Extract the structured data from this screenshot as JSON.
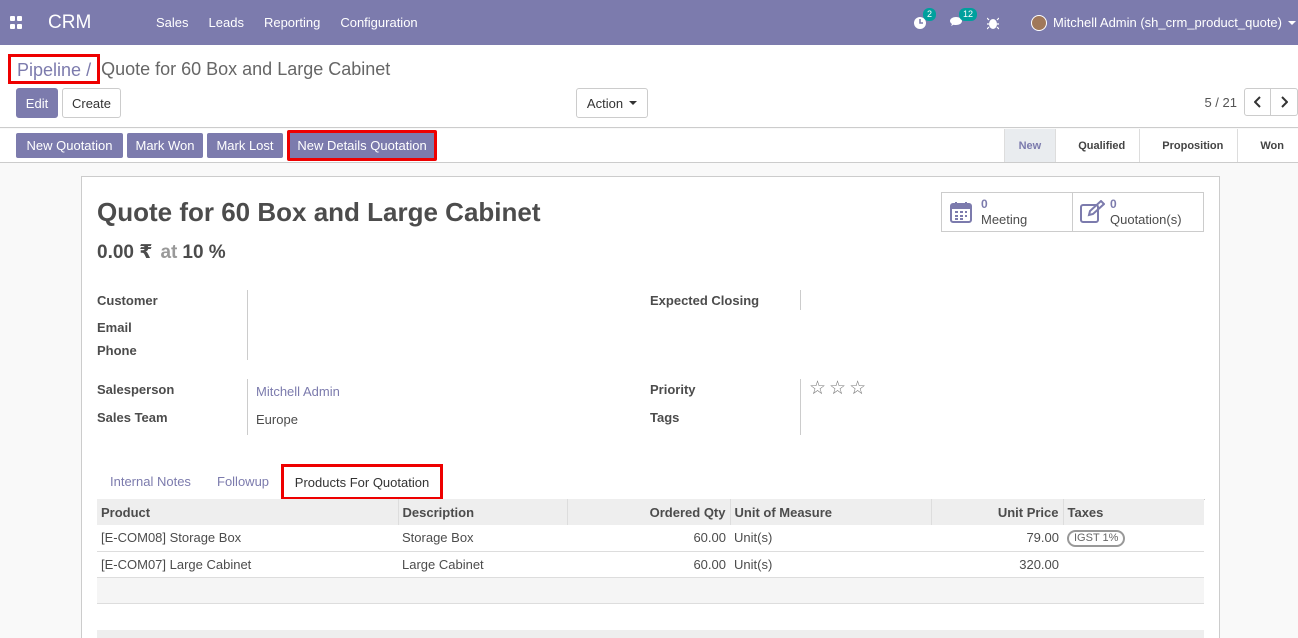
{
  "navbar": {
    "brand": "CRM",
    "menu": [
      "Sales",
      "Leads",
      "Reporting",
      "Configuration"
    ],
    "activity_count": "2",
    "message_count": "12",
    "user": "Mitchell Admin (sh_crm_product_quote)"
  },
  "breadcrumb": {
    "parent": "Pipeline",
    "separator": "/",
    "current": "Quote for 60 Box and Large Cabinet"
  },
  "buttons": {
    "edit": "Edit",
    "create": "Create",
    "action": "Action"
  },
  "pager": {
    "value": "5 / 21"
  },
  "statusbar": {
    "buttons": [
      "New Quotation",
      "Mark Won",
      "Mark Lost",
      "New Details Quotation"
    ],
    "stages": [
      "New",
      "Qualified",
      "Proposition",
      "Won"
    ],
    "active_stage": "New"
  },
  "record": {
    "title": "Quote for 60 Box and Large Cabinet",
    "revenue": "0.00 ₹",
    "at": "at",
    "probability": "10 %",
    "smart_buttons": [
      {
        "count": "0",
        "label": "Meeting",
        "icon": "calendar-icon"
      },
      {
        "count": "0",
        "label": "Quotation(s)",
        "icon": "edit-icon"
      }
    ],
    "labels": {
      "customer": "Customer",
      "email": "Email",
      "phone": "Phone",
      "expected_closing": "Expected Closing",
      "salesperson": "Salesperson",
      "sales_team": "Sales Team",
      "priority": "Priority",
      "tags": "Tags"
    },
    "salesperson": "Mitchell Admin",
    "sales_team": "Europe",
    "priority_stars": 0
  },
  "tabs": [
    "Internal Notes",
    "Followup",
    "Products For Quotation"
  ],
  "table": {
    "headers": [
      "Product",
      "Description",
      "Ordered Qty",
      "Unit of Measure",
      "Unit Price",
      "Taxes"
    ],
    "rows": [
      [
        "[E-COM08] Storage Box",
        "Storage Box",
        "60.00",
        "Unit(s)",
        "79.00",
        "IGST 1%"
      ],
      [
        "[E-COM07] Large Cabinet",
        "Large Cabinet",
        "60.00",
        "Unit(s)",
        "320.00",
        ""
      ]
    ]
  },
  "colors": {
    "brand": "#7c7bad",
    "highlight": "#e00000"
  }
}
